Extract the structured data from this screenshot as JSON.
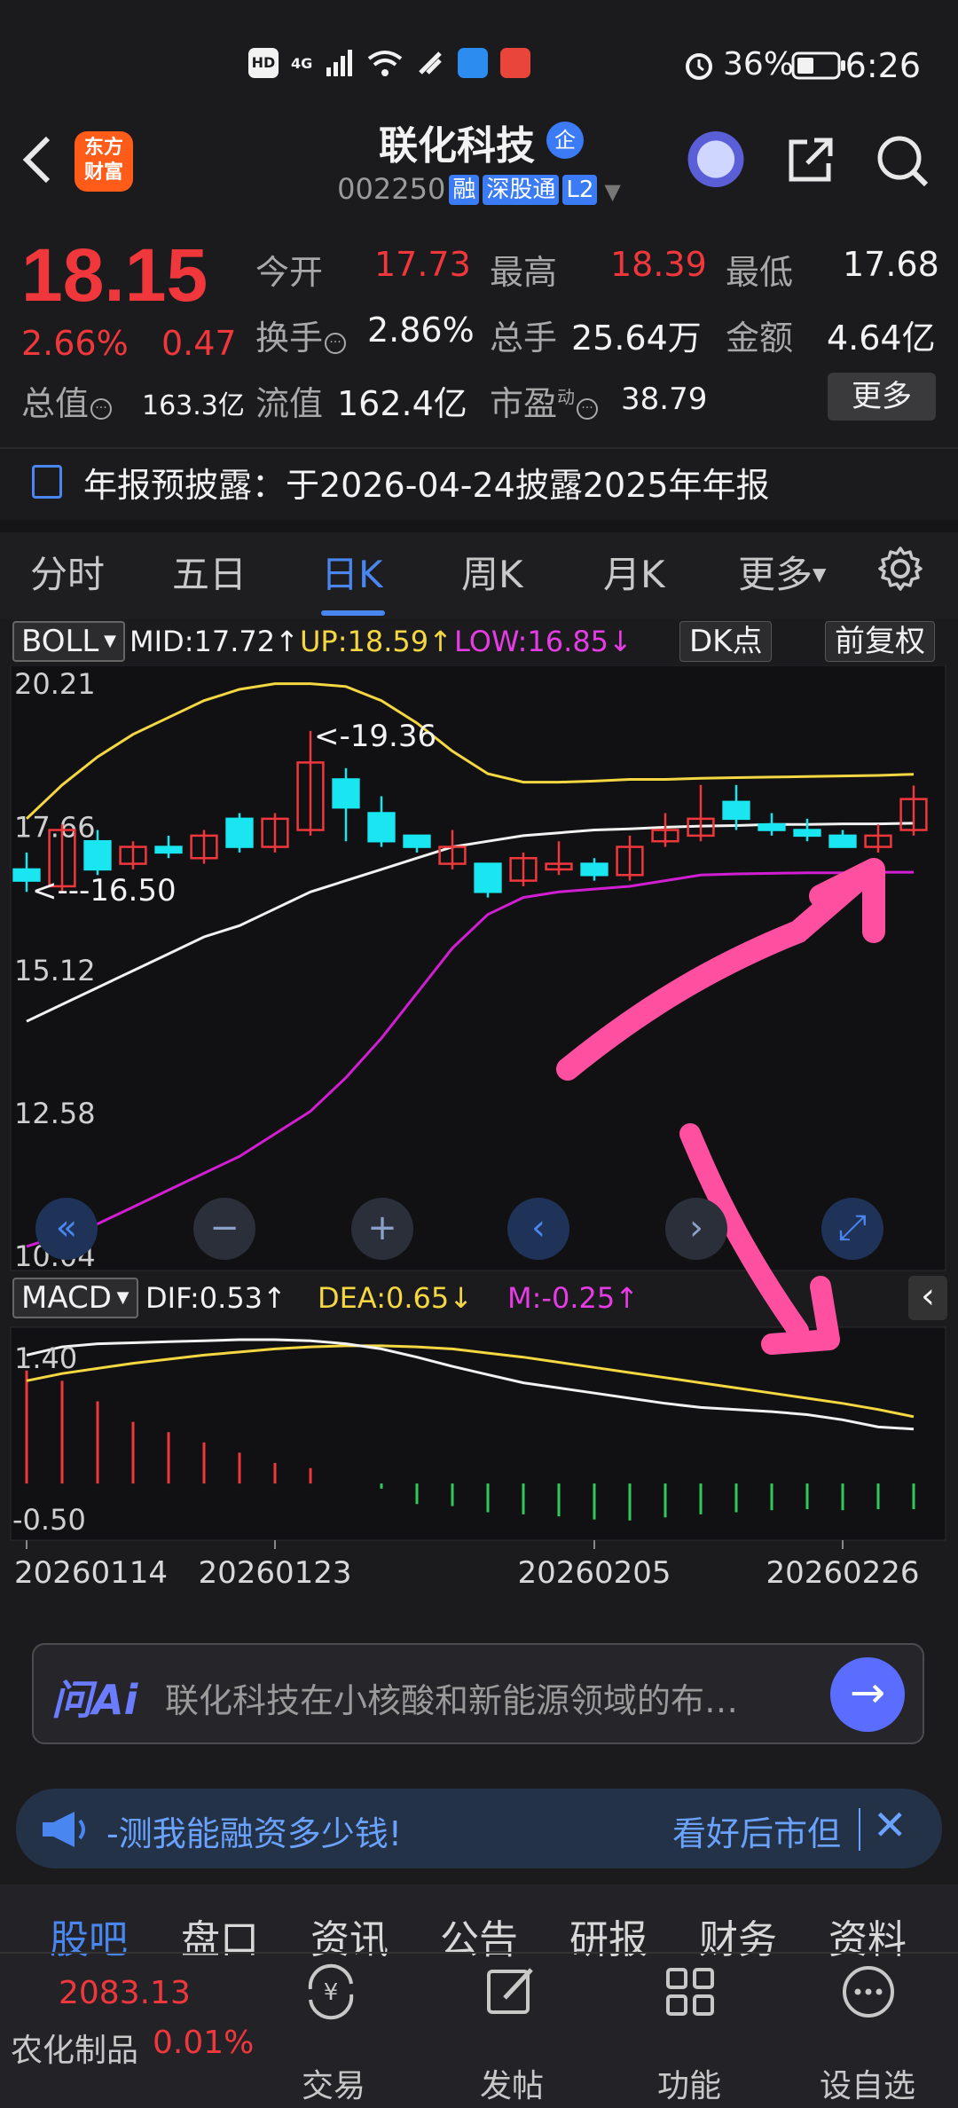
{
  "status": {
    "left_icons": [
      "HD",
      "4G",
      "signal",
      "wifi",
      "data-saver",
      "weather",
      "app-red"
    ],
    "battery_percent": "36%",
    "time": "6:26"
  },
  "header": {
    "logo_text": "东方\n财富",
    "stock_name": "联化科技",
    "badge": "企",
    "code": "002250",
    "tags": [
      "融",
      "深股通",
      "L2"
    ]
  },
  "quote": {
    "price": "18.15",
    "change_pct": "2.66%",
    "change_val": "0.47",
    "fields": {
      "open_label": "今开",
      "open": "17.73",
      "high_label": "最高",
      "high": "18.39",
      "low_label": "最低",
      "low": "17.68",
      "turnover_label": "换手",
      "turnover": "2.86%",
      "volume_label": "总手",
      "volume": "25.64万",
      "amount_label": "金额",
      "amount": "4.64亿",
      "mcap_label": "总值",
      "mcap": "163.3亿",
      "float_label": "流值",
      "float": "162.4亿",
      "pe_label": "市盈",
      "pe_sup": "动",
      "pe": "38.79"
    },
    "more": "更多"
  },
  "notice": "年报预披露：于2026-04-24披露2025年年报",
  "tabs": [
    "分时",
    "五日",
    "日K",
    "周K",
    "月K",
    "更多"
  ],
  "active_tab": "日K",
  "boll": {
    "name": "BOLL",
    "mid": "MID:17.72↑",
    "up": "UP:18.59↑",
    "low": "LOW:16.85↓",
    "dk_btn": "DK点",
    "fq_btn": "前复权"
  },
  "price_axis": [
    "20.21",
    "17.66",
    "15.12",
    "12.58",
    "10.04"
  ],
  "annotations": {
    "high": "<-19.36",
    "low": "<---16.50"
  },
  "macd": {
    "name": "MACD",
    "dif": "DIF:0.53↑",
    "dea": "DEA:0.65↓",
    "m": "M:-0.25↑",
    "axis_top": "1.40",
    "axis_bottom": "-0.50"
  },
  "dates": [
    "20260114",
    "20260123",
    "20260205",
    "20260226"
  ],
  "ai": {
    "logo": "问Ai",
    "text": "联化科技在小核酸和新能源领域的布…"
  },
  "promo": {
    "left": "-测我能融资多少钱!",
    "right": "看好后市但"
  },
  "bottom_tabs": [
    "股吧",
    "盘口",
    "资讯",
    "公告",
    "研报",
    "财务",
    "资料"
  ],
  "active_bottom_tab": "股吧",
  "index": {
    "value": "2083.13",
    "name": "农化制品",
    "pct": "0.01%"
  },
  "bottom_nav": [
    "交易",
    "发帖",
    "功能",
    "设自选"
  ],
  "colors": {
    "red": "#f0373c",
    "cyan": "#19e6f0",
    "yellow": "#f5d742",
    "magenta": "#d21ed2",
    "blue": "#4a86f0",
    "pink_arrow": "#ff4fa0"
  },
  "chart_data": {
    "type": "candlestick",
    "price_range": [
      10.04,
      20.21
    ],
    "candles": [
      {
        "o": 16.9,
        "c": 16.7,
        "h": 17.2,
        "l": 16.5
      },
      {
        "o": 16.6,
        "c": 17.6,
        "h": 17.7,
        "l": 16.5
      },
      {
        "o": 17.4,
        "c": 16.9,
        "h": 17.6,
        "l": 16.8
      },
      {
        "o": 17.0,
        "c": 17.3,
        "h": 17.4,
        "l": 16.9
      },
      {
        "o": 17.3,
        "c": 17.2,
        "h": 17.5,
        "l": 17.1
      },
      {
        "o": 17.1,
        "c": 17.5,
        "h": 17.6,
        "l": 17.0
      },
      {
        "o": 17.8,
        "c": 17.3,
        "h": 17.9,
        "l": 17.2
      },
      {
        "o": 17.3,
        "c": 17.8,
        "h": 17.9,
        "l": 17.2
      },
      {
        "o": 17.6,
        "c": 18.8,
        "h": 19.36,
        "l": 17.5
      },
      {
        "o": 18.5,
        "c": 18.0,
        "h": 18.7,
        "l": 17.4
      },
      {
        "o": 17.9,
        "c": 17.4,
        "h": 18.2,
        "l": 17.3
      },
      {
        "o": 17.5,
        "c": 17.3,
        "h": 17.5,
        "l": 17.2
      },
      {
        "o": 17.0,
        "c": 17.3,
        "h": 17.6,
        "l": 16.9
      },
      {
        "o": 17.0,
        "c": 16.5,
        "h": 17.0,
        "l": 16.4
      },
      {
        "o": 16.7,
        "c": 17.1,
        "h": 17.2,
        "l": 16.6
      },
      {
        "o": 16.9,
        "c": 17.0,
        "h": 17.4,
        "l": 16.8
      },
      {
        "o": 17.0,
        "c": 16.8,
        "h": 17.1,
        "l": 16.7
      },
      {
        "o": 16.8,
        "c": 17.3,
        "h": 17.5,
        "l": 16.7
      },
      {
        "o": 17.4,
        "c": 17.6,
        "h": 17.9,
        "l": 17.3
      },
      {
        "o": 17.5,
        "c": 17.8,
        "h": 18.4,
        "l": 17.4
      },
      {
        "o": 18.1,
        "c": 17.8,
        "h": 18.4,
        "l": 17.6
      },
      {
        "o": 17.7,
        "c": 17.6,
        "h": 17.9,
        "l": 17.5
      },
      {
        "o": 17.6,
        "c": 17.5,
        "h": 17.8,
        "l": 17.4
      },
      {
        "o": 17.5,
        "c": 17.3,
        "h": 17.6,
        "l": 17.3
      },
      {
        "o": 17.3,
        "c": 17.5,
        "h": 17.7,
        "l": 17.2
      },
      {
        "o": 17.6,
        "c": 18.15,
        "h": 18.39,
        "l": 17.5
      }
    ],
    "mid": [
      14.2,
      14.5,
      14.8,
      15.1,
      15.4,
      15.7,
      15.9,
      16.2,
      16.5,
      16.7,
      16.9,
      17.1,
      17.3,
      17.4,
      17.5,
      17.55,
      17.6,
      17.62,
      17.65,
      17.67,
      17.68,
      17.7,
      17.7,
      17.71,
      17.71,
      17.72
    ],
    "up": [
      17.8,
      18.4,
      18.9,
      19.3,
      19.6,
      19.9,
      20.1,
      20.2,
      20.2,
      20.15,
      19.9,
      19.5,
      19.0,
      18.6,
      18.45,
      18.45,
      18.47,
      18.5,
      18.5,
      18.52,
      18.53,
      18.54,
      18.55,
      18.56,
      18.57,
      18.59
    ],
    "low": [
      10.2,
      10.4,
      10.6,
      10.9,
      11.2,
      11.5,
      11.8,
      12.2,
      12.6,
      13.2,
      13.9,
      14.7,
      15.5,
      16.1,
      16.4,
      16.5,
      16.55,
      16.6,
      16.7,
      16.8,
      16.82,
      16.83,
      16.84,
      16.84,
      16.85,
      16.85
    ],
    "macd_range": [
      -0.5,
      1.4
    ],
    "dif": [
      1.25,
      1.33,
      1.36,
      1.37,
      1.38,
      1.39,
      1.4,
      1.4,
      1.39,
      1.36,
      1.31,
      1.23,
      1.14,
      1.06,
      0.98,
      0.93,
      0.88,
      0.83,
      0.78,
      0.74,
      0.72,
      0.7,
      0.67,
      0.62,
      0.55,
      0.53
    ],
    "dea": [
      1.0,
      1.07,
      1.12,
      1.17,
      1.21,
      1.25,
      1.28,
      1.31,
      1.33,
      1.34,
      1.34,
      1.33,
      1.31,
      1.27,
      1.23,
      1.18,
      1.13,
      1.08,
      1.03,
      0.98,
      0.93,
      0.88,
      0.83,
      0.78,
      0.72,
      0.65
    ],
    "hist": [
      1.1,
      1.0,
      0.8,
      0.6,
      0.5,
      0.4,
      0.3,
      0.2,
      0.15,
      0.0,
      -0.05,
      -0.2,
      -0.22,
      -0.28,
      -0.3,
      -0.32,
      -0.35,
      -0.36,
      -0.33,
      -0.3,
      -0.28,
      -0.26,
      -0.25,
      -0.26,
      -0.25,
      -0.25
    ]
  }
}
